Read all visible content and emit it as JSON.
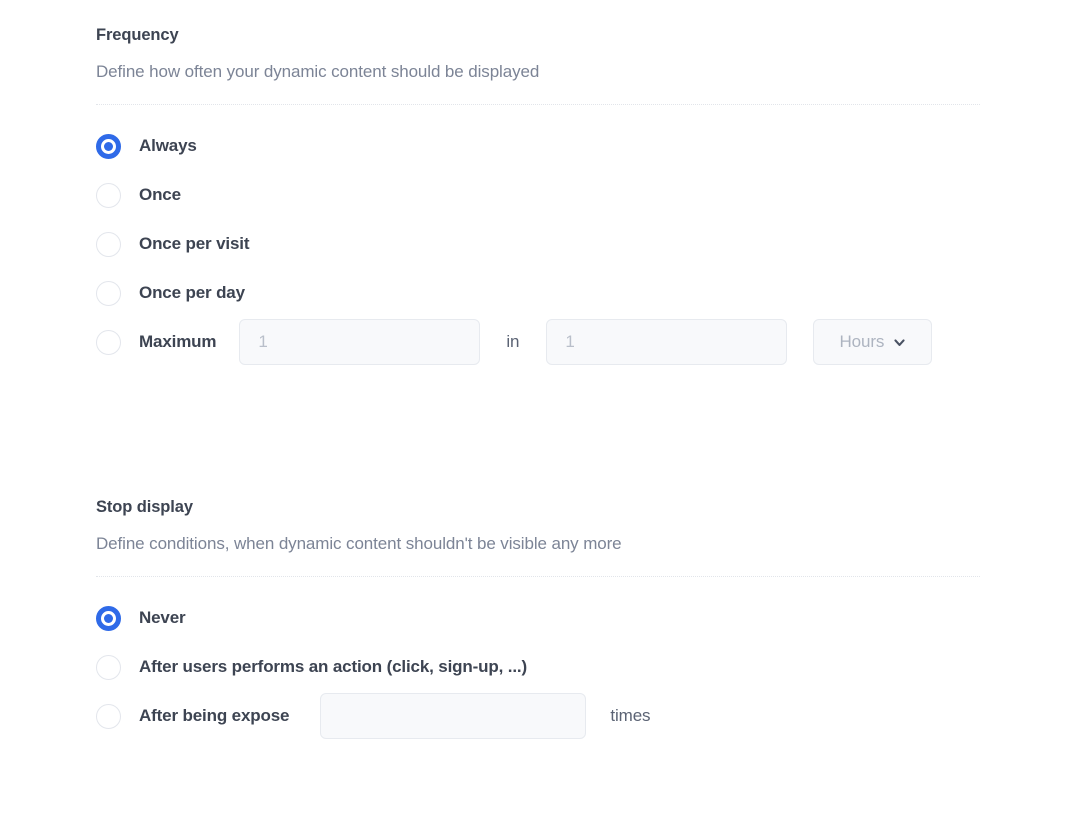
{
  "frequency": {
    "title": "Frequency",
    "subtitle": "Define how often your dynamic content should be displayed",
    "options": [
      {
        "label": "Always",
        "selected": true
      },
      {
        "label": "Once",
        "selected": false
      },
      {
        "label": "Once per visit",
        "selected": false
      },
      {
        "label": "Once per day",
        "selected": false
      },
      {
        "label": "Maximum",
        "selected": false
      }
    ],
    "maximum_row": {
      "count_value": "",
      "count_placeholder": "1",
      "between_label": "in",
      "period_value": "",
      "period_placeholder": "1",
      "unit_select_value": "Hours",
      "unit_select_icon": "chevron-down-icon"
    }
  },
  "stop_display": {
    "title": "Stop display",
    "subtitle": "Define conditions, when dynamic content shouldn't be visible any more",
    "options": [
      {
        "label": "Never",
        "selected": true
      },
      {
        "label": "After users performs an action (click, sign-up, ...)",
        "selected": false
      },
      {
        "label": "After being expose",
        "selected": false
      }
    ],
    "expose_row": {
      "times_value": "",
      "times_placeholder": "",
      "times_label": "times"
    }
  },
  "colors": {
    "accent": "#2f6ae8",
    "text": "#3d4452",
    "muted": "#7c8496",
    "field_bg": "#f8f9fb",
    "border": "#e7eaef"
  }
}
